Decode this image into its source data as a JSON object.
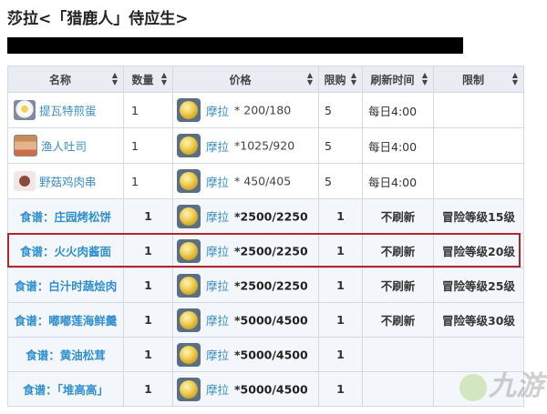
{
  "title": "莎拉<「猎鹿人」侍应生>",
  "headers": {
    "name": "名称",
    "qty": "数量",
    "price": "价格",
    "limit": "限购",
    "refresh": "刷新时间",
    "restrict": "限制"
  },
  "rows": [
    {
      "name": "提瓦特煎蛋",
      "thumb": "egg",
      "qty": "1",
      "currency": "摩拉",
      "price": "* 200/180",
      "limit": "5",
      "refresh": "每日4:00",
      "restrict": ""
    },
    {
      "name": "渔人吐司",
      "thumb": "toast",
      "qty": "1",
      "currency": "摩拉",
      "price": "*1025/920",
      "limit": "5",
      "refresh": "每日4:00",
      "restrict": ""
    },
    {
      "name": "野菇鸡肉串",
      "thumb": "skewer",
      "qty": "1",
      "currency": "摩拉",
      "price": "* 450/405",
      "limit": "5",
      "refresh": "每日4:00",
      "restrict": ""
    },
    {
      "name": "食谱：庄园烤松饼",
      "qty": "1",
      "currency": "摩拉",
      "price": "*2500/2250",
      "limit": "1",
      "refresh": "不刷新",
      "restrict": "冒险等级15级"
    },
    {
      "name": "食谱：火火肉酱面",
      "qty": "1",
      "currency": "摩拉",
      "price": "*2500/2250",
      "limit": "1",
      "refresh": "不刷新",
      "restrict": "冒险等级20级"
    },
    {
      "name": "食谱：白汁时蔬烩肉",
      "qty": "1",
      "currency": "摩拉",
      "price": "*2500/2250",
      "limit": "1",
      "refresh": "不刷新",
      "restrict": "冒险等级25级"
    },
    {
      "name": "食谱：嘟嘟莲海鲜羹",
      "qty": "1",
      "currency": "摩拉",
      "price": "*5000/4500",
      "limit": "1",
      "refresh": "不刷新",
      "restrict": "冒险等级30级"
    },
    {
      "name": "食谱：黄油松茸",
      "qty": "1",
      "currency": "摩拉",
      "price": "*5000/4500",
      "limit": "1",
      "refresh": "",
      "restrict": ""
    },
    {
      "name": "食谱：「堆高高」",
      "qty": "1",
      "currency": "摩拉",
      "price": "*5000/4500",
      "limit": "1",
      "refresh": "",
      "restrict": ""
    }
  ],
  "watermark": "九游"
}
